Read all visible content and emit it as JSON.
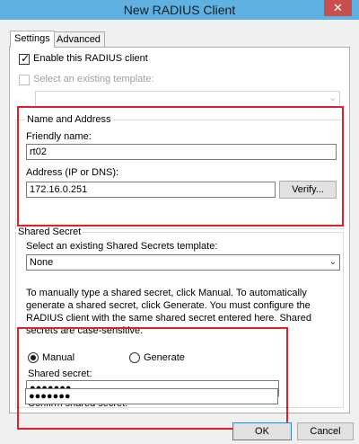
{
  "window": {
    "title": "New RADIUS Client",
    "close_label": "✕"
  },
  "tabs": [
    {
      "label": "Settings"
    },
    {
      "label": "Advanced"
    }
  ],
  "enable_client": {
    "label": "Enable this RADIUS client",
    "checked_glyph": "✓"
  },
  "existing_template": {
    "label": "Select an existing template:",
    "selected": "",
    "arrow": "⌄"
  },
  "name_address": {
    "group_label": "Name and Address",
    "friendly_label": "Friendly name:",
    "friendly_value": "rt02",
    "address_label": "Address (IP or DNS):",
    "address_value": "172.16.0.251",
    "verify_label": "Verify..."
  },
  "shared_secret": {
    "group_label": "Shared Secret",
    "template_label": "Select an existing Shared Secrets template:",
    "template_value": "None",
    "arrow": "⌄",
    "description": "To manually type a shared secret, click Manual. To automatically generate a shared secret, click Generate. You must configure the RADIUS client with the same shared secret entered here. Shared secrets are case-sensitive.",
    "manual_label": "Manual",
    "generate_label": "Generate",
    "secret_label": "Shared secret:",
    "secret_value": "●●●●●●●",
    "confirm_label": "Confirm shared secret:",
    "confirm_value": "●●●●●●●"
  },
  "buttons": {
    "ok": "OK",
    "cancel": "Cancel"
  }
}
